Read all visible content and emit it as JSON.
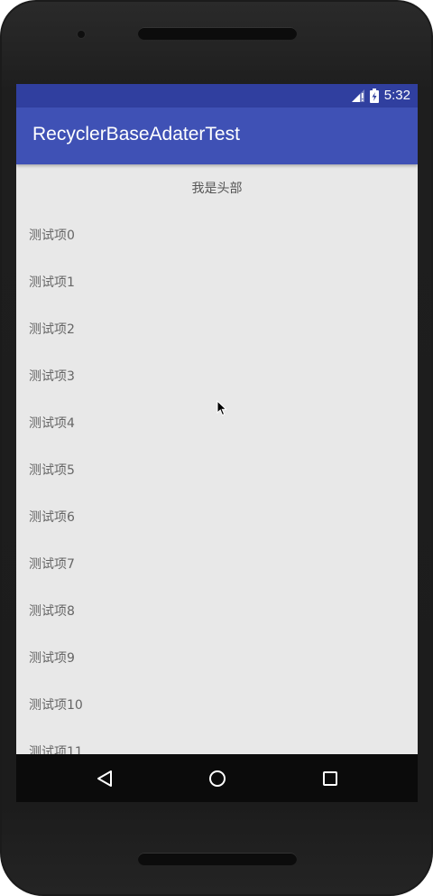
{
  "status_bar": {
    "time": "5:32",
    "icons": [
      "signal-icon",
      "battery-charging-icon"
    ]
  },
  "app_bar": {
    "title": "RecyclerBaseAdaterTest"
  },
  "list": {
    "header": "我是头部",
    "items": [
      "测试项0",
      "测试项1",
      "测试项2",
      "测试项3",
      "测试项4",
      "测试项5",
      "测试项6",
      "测试项7",
      "测试项8",
      "测试项9",
      "测试项10",
      "测试项11"
    ]
  },
  "nav_bar": {
    "icons": [
      "back-icon",
      "home-icon",
      "recents-icon"
    ]
  },
  "colors": {
    "primary": "#3f51b5",
    "primary_dark": "#303f9f",
    "background": "#e8e8e8",
    "nav_bar": "#0b0b0b"
  }
}
